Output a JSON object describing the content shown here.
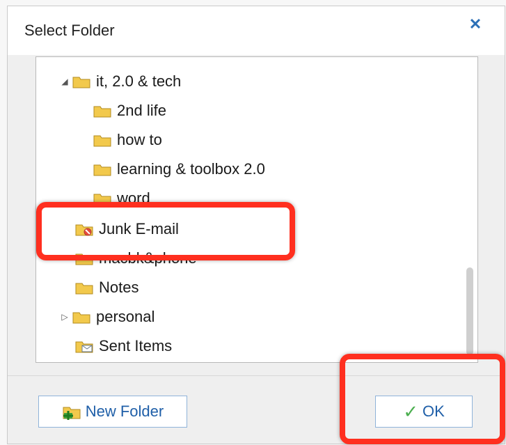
{
  "dialog": {
    "title": "Select Folder",
    "close_icon": "close-icon"
  },
  "tree": {
    "items": [
      {
        "label": "it, 2.0 & tech",
        "expanded": true
      },
      {
        "label": "2nd life"
      },
      {
        "label": "how to"
      },
      {
        "label": "learning & toolbox 2.0"
      },
      {
        "label": "word"
      },
      {
        "label": "Junk E-mail"
      },
      {
        "label": "macbk&phone"
      },
      {
        "label": "Notes"
      },
      {
        "label": "personal",
        "collapsed": true
      },
      {
        "label": "Sent Items"
      }
    ]
  },
  "footer": {
    "new_folder": "New Folder",
    "ok": "OK"
  },
  "colors": {
    "highlight": "#ff2f1f",
    "link_blue": "#1f5fa8",
    "folder_yellow": "#f2c94c"
  }
}
